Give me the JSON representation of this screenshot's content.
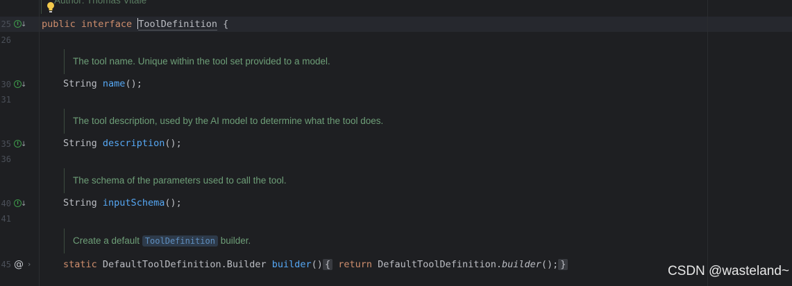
{
  "top_doc": {
    "text": "Author: Thomas Vitale"
  },
  "lines": [
    {
      "num": "25",
      "gutter": "implementing-icon"
    },
    {
      "num": "26"
    },
    {
      "num": "30",
      "gutter": "implementing-icon"
    },
    {
      "num": "31"
    },
    {
      "num": "35",
      "gutter": "implementing-icon"
    },
    {
      "num": "36"
    },
    {
      "num": "40",
      "gutter": "implementing-icon"
    },
    {
      "num": "41"
    },
    {
      "num": "45",
      "gutter": "at-icon"
    }
  ],
  "code": {
    "line25": {
      "kw1": "public",
      "kw2": "interface",
      "name": "ToolDefinition",
      "brace": "{"
    },
    "line30": {
      "type": "String",
      "method": "name",
      "rest": "();"
    },
    "line35": {
      "type": "String",
      "method": "description",
      "rest": "();"
    },
    "line40": {
      "type": "String",
      "method": "inputSchema",
      "rest": "();"
    },
    "line45": {
      "kw_static": "static",
      "type": "DefaultToolDefinition.Builder",
      "method": "builder",
      "parens": "()",
      "open_brace": "{",
      "kw_return": "return",
      "call_class": "DefaultToolDefinition.",
      "call_method": "builder",
      "call_rest": "();",
      "close_brace": "}"
    }
  },
  "docs": {
    "name_doc": "The tool name. Unique within the tool set provided to a model.",
    "description_doc": "The tool description, used by the AI model to determine what the tool does.",
    "schema_doc": "The schema of the parameters used to call the tool.",
    "builder_doc_before": "Create a default",
    "builder_doc_code": "ToolDefinition",
    "builder_doc_after": "builder."
  },
  "watermark": "CSDN @wasteland~"
}
